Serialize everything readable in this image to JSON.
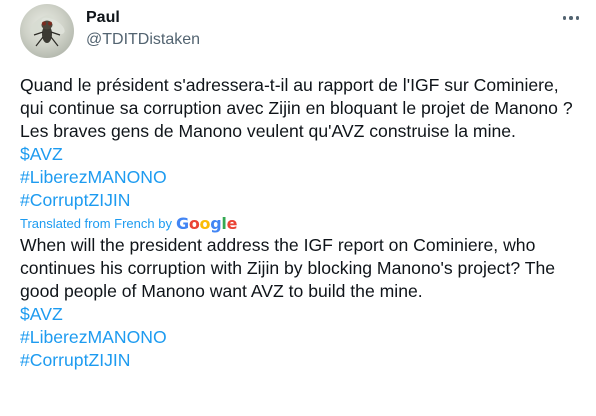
{
  "author": {
    "display_name": "Paul",
    "handle": "@TDITDistaken",
    "avatar_icon": "fly-avatar-icon"
  },
  "more_icon": "more-options-icon",
  "original": {
    "text": "Quand le président s'adressera-t-il au rapport de l'IGF sur Cominiere, qui continue sa corruption avec Zijin en bloquant le projet de Manono ? Les braves gens de Manono veulent qu'AVZ construise la mine.",
    "hashtags": [
      "$AVZ",
      "#LiberezMANONO",
      "#CorruptZIJIN"
    ]
  },
  "translation_note": {
    "label": "Translated from French by",
    "provider": "Google",
    "provider_letters": [
      "G",
      "o",
      "o",
      "g",
      "l",
      "e"
    ]
  },
  "translated": {
    "text": "When will the president address the IGF report on Cominiere, who continues his corruption with Zijin by blocking Manono's project? The good people of Manono want AVZ to build the mine.",
    "hashtags": [
      "$AVZ",
      "#LiberezMANONO",
      "#CorruptZIJIN"
    ]
  },
  "colors": {
    "link": "#1d9bf0",
    "text": "#0f1419",
    "secondary": "#536471"
  }
}
